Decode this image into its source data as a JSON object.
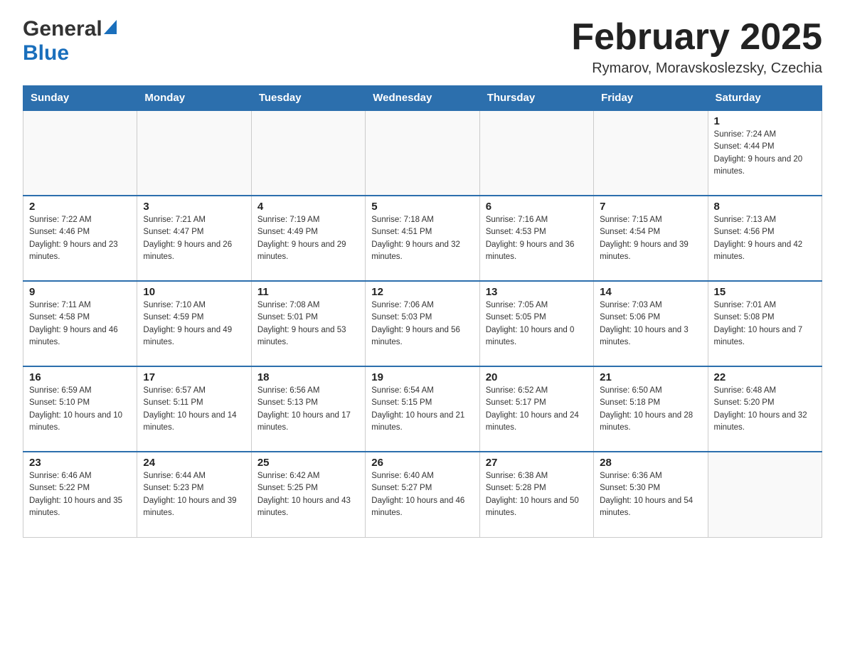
{
  "header": {
    "logo_general": "General",
    "logo_blue": "Blue",
    "month_title": "February 2025",
    "location": "Rymarov, Moravskoslezsky, Czechia"
  },
  "weekdays": [
    "Sunday",
    "Monday",
    "Tuesday",
    "Wednesday",
    "Thursday",
    "Friday",
    "Saturday"
  ],
  "weeks": [
    [
      {
        "day": "",
        "info": ""
      },
      {
        "day": "",
        "info": ""
      },
      {
        "day": "",
        "info": ""
      },
      {
        "day": "",
        "info": ""
      },
      {
        "day": "",
        "info": ""
      },
      {
        "day": "",
        "info": ""
      },
      {
        "day": "1",
        "info": "Sunrise: 7:24 AM\nSunset: 4:44 PM\nDaylight: 9 hours and 20 minutes."
      }
    ],
    [
      {
        "day": "2",
        "info": "Sunrise: 7:22 AM\nSunset: 4:46 PM\nDaylight: 9 hours and 23 minutes."
      },
      {
        "day": "3",
        "info": "Sunrise: 7:21 AM\nSunset: 4:47 PM\nDaylight: 9 hours and 26 minutes."
      },
      {
        "day": "4",
        "info": "Sunrise: 7:19 AM\nSunset: 4:49 PM\nDaylight: 9 hours and 29 minutes."
      },
      {
        "day": "5",
        "info": "Sunrise: 7:18 AM\nSunset: 4:51 PM\nDaylight: 9 hours and 32 minutes."
      },
      {
        "day": "6",
        "info": "Sunrise: 7:16 AM\nSunset: 4:53 PM\nDaylight: 9 hours and 36 minutes."
      },
      {
        "day": "7",
        "info": "Sunrise: 7:15 AM\nSunset: 4:54 PM\nDaylight: 9 hours and 39 minutes."
      },
      {
        "day": "8",
        "info": "Sunrise: 7:13 AM\nSunset: 4:56 PM\nDaylight: 9 hours and 42 minutes."
      }
    ],
    [
      {
        "day": "9",
        "info": "Sunrise: 7:11 AM\nSunset: 4:58 PM\nDaylight: 9 hours and 46 minutes."
      },
      {
        "day": "10",
        "info": "Sunrise: 7:10 AM\nSunset: 4:59 PM\nDaylight: 9 hours and 49 minutes."
      },
      {
        "day": "11",
        "info": "Sunrise: 7:08 AM\nSunset: 5:01 PM\nDaylight: 9 hours and 53 minutes."
      },
      {
        "day": "12",
        "info": "Sunrise: 7:06 AM\nSunset: 5:03 PM\nDaylight: 9 hours and 56 minutes."
      },
      {
        "day": "13",
        "info": "Sunrise: 7:05 AM\nSunset: 5:05 PM\nDaylight: 10 hours and 0 minutes."
      },
      {
        "day": "14",
        "info": "Sunrise: 7:03 AM\nSunset: 5:06 PM\nDaylight: 10 hours and 3 minutes."
      },
      {
        "day": "15",
        "info": "Sunrise: 7:01 AM\nSunset: 5:08 PM\nDaylight: 10 hours and 7 minutes."
      }
    ],
    [
      {
        "day": "16",
        "info": "Sunrise: 6:59 AM\nSunset: 5:10 PM\nDaylight: 10 hours and 10 minutes."
      },
      {
        "day": "17",
        "info": "Sunrise: 6:57 AM\nSunset: 5:11 PM\nDaylight: 10 hours and 14 minutes."
      },
      {
        "day": "18",
        "info": "Sunrise: 6:56 AM\nSunset: 5:13 PM\nDaylight: 10 hours and 17 minutes."
      },
      {
        "day": "19",
        "info": "Sunrise: 6:54 AM\nSunset: 5:15 PM\nDaylight: 10 hours and 21 minutes."
      },
      {
        "day": "20",
        "info": "Sunrise: 6:52 AM\nSunset: 5:17 PM\nDaylight: 10 hours and 24 minutes."
      },
      {
        "day": "21",
        "info": "Sunrise: 6:50 AM\nSunset: 5:18 PM\nDaylight: 10 hours and 28 minutes."
      },
      {
        "day": "22",
        "info": "Sunrise: 6:48 AM\nSunset: 5:20 PM\nDaylight: 10 hours and 32 minutes."
      }
    ],
    [
      {
        "day": "23",
        "info": "Sunrise: 6:46 AM\nSunset: 5:22 PM\nDaylight: 10 hours and 35 minutes."
      },
      {
        "day": "24",
        "info": "Sunrise: 6:44 AM\nSunset: 5:23 PM\nDaylight: 10 hours and 39 minutes."
      },
      {
        "day": "25",
        "info": "Sunrise: 6:42 AM\nSunset: 5:25 PM\nDaylight: 10 hours and 43 minutes."
      },
      {
        "day": "26",
        "info": "Sunrise: 6:40 AM\nSunset: 5:27 PM\nDaylight: 10 hours and 46 minutes."
      },
      {
        "day": "27",
        "info": "Sunrise: 6:38 AM\nSunset: 5:28 PM\nDaylight: 10 hours and 50 minutes."
      },
      {
        "day": "28",
        "info": "Sunrise: 6:36 AM\nSunset: 5:30 PM\nDaylight: 10 hours and 54 minutes."
      },
      {
        "day": "",
        "info": ""
      }
    ]
  ]
}
